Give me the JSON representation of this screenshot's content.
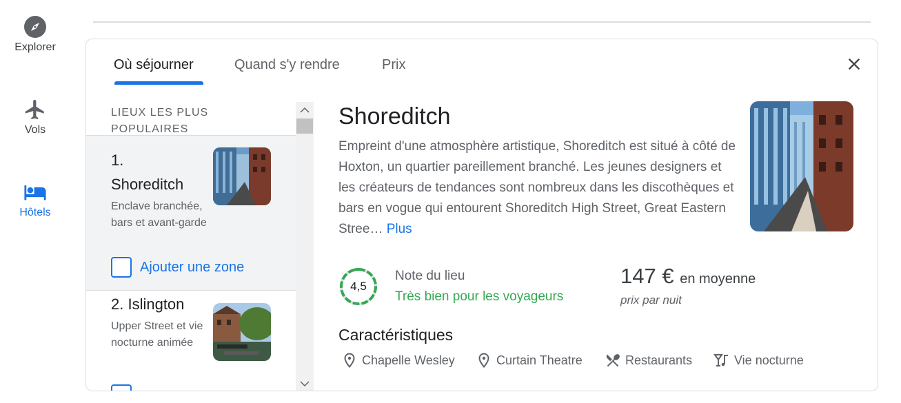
{
  "rail": {
    "items": [
      {
        "icon": "compass-icon",
        "label": "Explorer",
        "active": false
      },
      {
        "icon": "airplane-icon",
        "label": "Vols",
        "active": false
      },
      {
        "icon": "bed-icon",
        "label": "Hôtels",
        "active": true
      }
    ]
  },
  "tabs": [
    {
      "label": "Où séjourner",
      "active": true
    },
    {
      "label": "Quand s'y rendre",
      "active": false
    },
    {
      "label": "Prix",
      "active": false
    }
  ],
  "list": {
    "heading": "LIEUX LES PLUS POPULAIRES",
    "items": [
      {
        "title_num": "1.",
        "title": "Shoreditch",
        "desc": "Enclave branchée, bars et avant-garde",
        "add_label": "Ajouter une zone",
        "selected": true
      },
      {
        "title": "2. Islington",
        "desc": "Upper Street et vie nocturne animée"
      }
    ]
  },
  "detail": {
    "title": "Shoreditch",
    "description": "Empreint d'une atmosphère artistique, Shoreditch est situé à côté de Hoxton, un quartier pareillement branché. Les jeunes designers et les créateurs de tendances sont nombreux dans les discothèques et bars en vogue qui entourent Shoreditch High Street, Great Eastern Stree…",
    "more_label": "Plus",
    "rating": {
      "value": "4,5",
      "label": "Note du lieu",
      "verdict": "Très bien pour les voyageurs",
      "fraction": 0.9
    },
    "price": {
      "amount": "147 €",
      "suffix": "en moyenne",
      "sub": "prix par nuit"
    },
    "features_title": "Caractéristiques",
    "features": [
      {
        "icon": "location-pin-icon",
        "label": "Chapelle Wesley"
      },
      {
        "icon": "location-pin-icon",
        "label": "Curtain Theatre"
      },
      {
        "icon": "restaurant-icon",
        "label": "Restaurants"
      },
      {
        "icon": "nightlife-icon",
        "label": "Vie nocturne"
      }
    ]
  },
  "colors": {
    "accent": "#1a73e8",
    "positive": "#34a853",
    "text": "#202124",
    "muted": "#5f6368"
  }
}
